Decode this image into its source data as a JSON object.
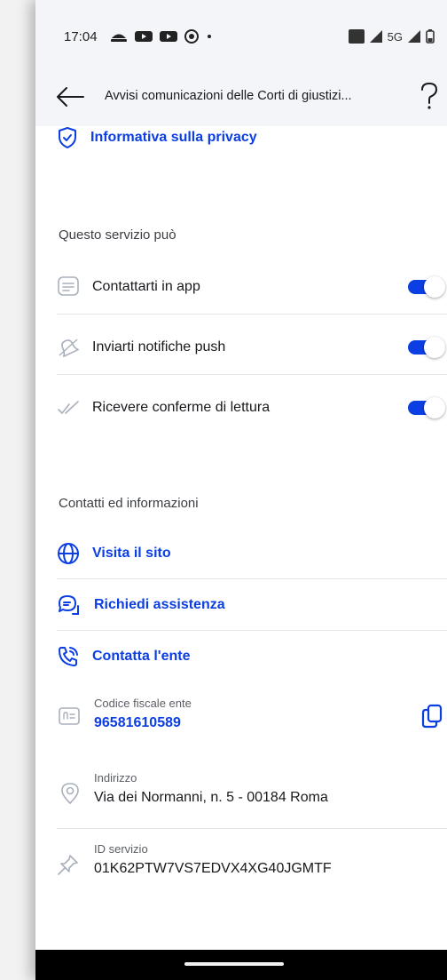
{
  "status_bar": {
    "time": "17:04",
    "network": "5G"
  },
  "app_bar": {
    "title": "Avvisi comunicazioni delle Corti di giustizi..."
  },
  "privacy_link": {
    "label": "Informativa sulla privacy"
  },
  "preferences": {
    "section_title": "Questo servizio può",
    "items": [
      {
        "label": "Contattarti in app",
        "icon": "message-icon",
        "enabled": true
      },
      {
        "label": "Inviarti notifiche push",
        "icon": "bell-icon",
        "enabled": true
      },
      {
        "label": "Ricevere conferme di lettura",
        "icon": "double-check-icon",
        "enabled": true
      }
    ]
  },
  "contacts": {
    "section_title": "Contatti ed informazioni",
    "links": [
      {
        "label": "Visita il sito",
        "icon": "globe-icon"
      },
      {
        "label": "Richiedi assistenza",
        "icon": "chat-support-icon"
      },
      {
        "label": "Contatta l'ente",
        "icon": "phone-icon"
      }
    ],
    "fiscal_code": {
      "label": "Codice fiscale ente",
      "value": "96581610589"
    },
    "address": {
      "label": "Indirizzo",
      "value": "Via dei Normanni, n. 5 - 00184 Roma"
    },
    "service_id": {
      "label": "ID servizio",
      "value": "01K62PTW7VS7EDVX4XG40JGMTF"
    }
  },
  "colors": {
    "accent": "#0b3ee3",
    "background_header": "#f4f5f8",
    "text": "#17191c"
  }
}
